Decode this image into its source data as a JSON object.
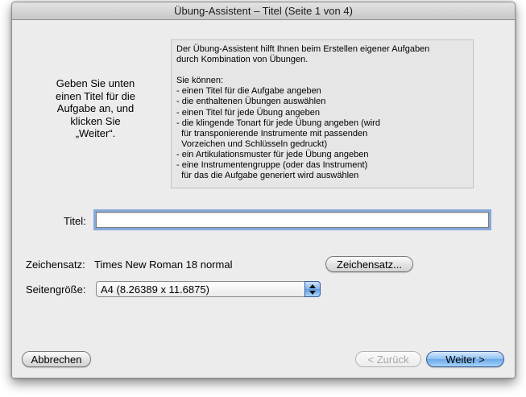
{
  "window": {
    "title": "Übung-Assistent – Titel (Seite 1 von 4)"
  },
  "instructions": {
    "lines": [
      "Geben Sie unten",
      "einen Titel für die",
      "Aufgabe an, und",
      "klicken Sie",
      "„Weiter“."
    ]
  },
  "info": {
    "lines": [
      "Der Übung-Assistent hilft Ihnen beim Erstellen eigener Aufgaben",
      "durch Kombination von Übungen.",
      "",
      "Sie können:",
      "- einen Titel für die Aufgabe angeben",
      "- die enthaltenen Übungen auswählen",
      "- einen Titel für jede Übung angeben",
      "- die klingende Tonart für jede Übung angeben (wird",
      "  für transponierende Instrumente mit passenden",
      "  Vorzeichen und Schlüsseln gedruckt)",
      "- ein Artikulationsmuster für jede Übung angeben",
      "- eine Instrumentengruppe (oder das Instrument)",
      "  für das die Aufgabe generiert wird auswählen"
    ]
  },
  "form": {
    "title_label": "Titel:",
    "title_value": "",
    "font_label": "Zeichensatz:",
    "font_value": "Times New Roman 18 normal",
    "font_button": "Zeichensatz...",
    "page_size_label": "Seitengröße:",
    "page_size_value": "A4 (8.26389 x 11.6875)"
  },
  "buttons": {
    "cancel": "Abbrechen",
    "back": "< Zurück",
    "next": "Weiter >"
  }
}
